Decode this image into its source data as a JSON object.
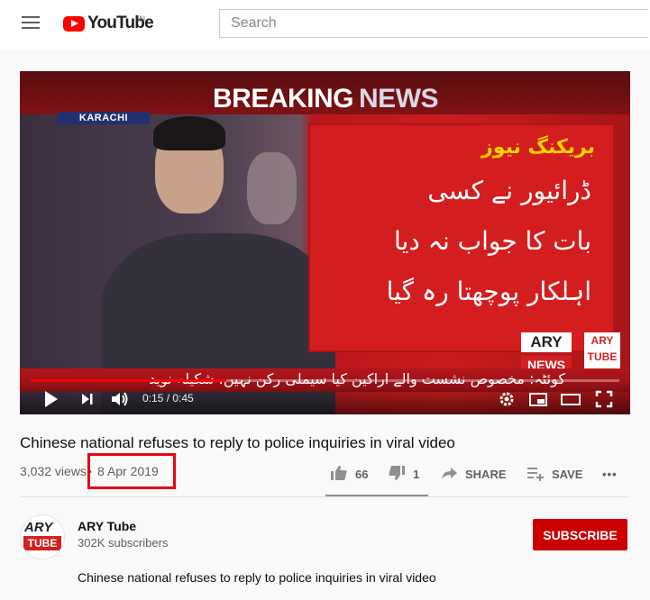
{
  "header": {
    "logo_text": "YouTube",
    "country_code": "IN",
    "search_placeholder": "Search"
  },
  "player": {
    "overlay": {
      "breaking": "BREAKING",
      "news": "NEWS",
      "city": "KARACHI",
      "urdu_headline_1": "بریکنگ نیوز",
      "urdu_headline_2": "ڈرائیور نے کسی",
      "urdu_headline_3": "بات کا جواب نہ دیا",
      "urdu_headline_4": "اہلکار پوچھتا رہ گیا",
      "ticker": "کوئٹہ: مخصوص نشست والے اراکین کیا سیملی رکن نہیں، شکیلہ نوید",
      "badge_top": "ARY",
      "badge_bottom": "NEWS",
      "badge_side": "ARY TUBE"
    },
    "current_time": "0:15",
    "duration": "0:45",
    "time_display": "0:15 / 0:45",
    "progress": 0.333
  },
  "video": {
    "title": "Chinese national refuses to reply to police inquiries in viral video",
    "views": "3,032 views",
    "separator": "•",
    "date": "8 Apr 2019",
    "likes": "66",
    "dislikes": "1",
    "share_label": "SHARE",
    "save_label": "SAVE",
    "more_label": "•••"
  },
  "channel": {
    "avatar_top": "ARY",
    "avatar_bottom": "TUBE",
    "name": "ARY Tube",
    "subscribers": "302K subscribers",
    "subscribe_label": "SUBSCRIBE"
  },
  "description": "Chinese national refuses to reply to police inquiries in viral video",
  "colors": {
    "brand_red": "#ff0000",
    "subscribe_red": "#cc0000",
    "highlight_box": "#e30613"
  }
}
